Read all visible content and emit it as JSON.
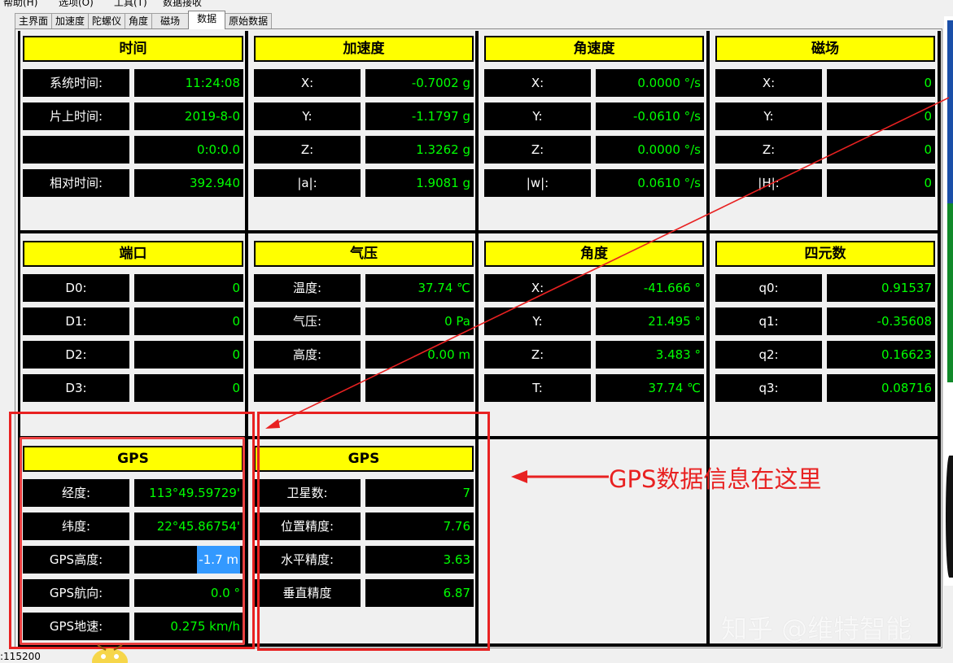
{
  "menubar": [
    "帮助(H)",
    "选项(O)",
    "工具(T)",
    "数据接收"
  ],
  "tabs": [
    "主界面",
    "加速度",
    "陀螺仪",
    "角度",
    "磁场",
    "数据",
    "原始数据"
  ],
  "active_tab": "数据",
  "groups": {
    "time": {
      "title": "时间",
      "rows": [
        {
          "label": "系统时间:",
          "value": "11:24:08"
        },
        {
          "label": "片上时间:",
          "value": "2019-8-0"
        },
        {
          "label": "",
          "value": "0:0:0.0"
        },
        {
          "label": "相对时间:",
          "value": "392.940"
        }
      ]
    },
    "acc": {
      "title": "加速度",
      "rows": [
        {
          "label": "X:",
          "value": "-0.7002 g"
        },
        {
          "label": "Y:",
          "value": "-1.1797 g"
        },
        {
          "label": "Z:",
          "value": "1.3262 g"
        },
        {
          "label": "|a|:",
          "value": "1.9081 g"
        }
      ]
    },
    "gyro": {
      "title": "角速度",
      "rows": [
        {
          "label": "X:",
          "value": "0.0000 °/s"
        },
        {
          "label": "Y:",
          "value": "-0.0610 °/s"
        },
        {
          "label": "Z:",
          "value": "0.0000 °/s"
        },
        {
          "label": "|w|:",
          "value": "0.0610 °/s"
        }
      ]
    },
    "mag": {
      "title": "磁场",
      "rows": [
        {
          "label": "X:",
          "value": "0"
        },
        {
          "label": "Y:",
          "value": "0"
        },
        {
          "label": "Z:",
          "value": "0"
        },
        {
          "label": "|H|:",
          "value": "0"
        }
      ]
    },
    "port": {
      "title": "端口",
      "rows": [
        {
          "label": "D0:",
          "value": "0"
        },
        {
          "label": "D1:",
          "value": "0"
        },
        {
          "label": "D2:",
          "value": "0"
        },
        {
          "label": "D3:",
          "value": "0"
        }
      ]
    },
    "pressure": {
      "title": "气压",
      "rows": [
        {
          "label": "温度:",
          "value": "37.74 ℃"
        },
        {
          "label": "气压:",
          "value": "0 Pa"
        },
        {
          "label": "高度:",
          "value": "0.00 m"
        },
        {
          "label": "",
          "value": ""
        }
      ]
    },
    "angle": {
      "title": "角度",
      "rows": [
        {
          "label": "X:",
          "value": "-41.666 °"
        },
        {
          "label": "Y:",
          "value": "21.495 °"
        },
        {
          "label": "Z:",
          "value": "3.483 °"
        },
        {
          "label": "T:",
          "value": "37.74 ℃"
        }
      ]
    },
    "quat": {
      "title": "四元数",
      "rows": [
        {
          "label": "q0:",
          "value": "0.91537"
        },
        {
          "label": "q1:",
          "value": "-0.35608"
        },
        {
          "label": "q2:",
          "value": "0.16623"
        },
        {
          "label": "q3:",
          "value": "0.08716"
        }
      ]
    },
    "gps1": {
      "title": "GPS",
      "rows": [
        {
          "label": "经度:",
          "value": "113°49.59729'"
        },
        {
          "label": "纬度:",
          "value": "22°45.86754'"
        },
        {
          "label": "GPS高度:",
          "value": "-1.7 m"
        },
        {
          "label": "GPS航向:",
          "value": "0.0 °"
        },
        {
          "label": "GPS地速:",
          "value": "0.275 km/h"
        }
      ]
    },
    "gps2": {
      "title": "GPS",
      "rows": [
        {
          "label": "卫星数:",
          "value": "7"
        },
        {
          "label": "位置精度:",
          "value": "7.76"
        },
        {
          "label": "水平精度:",
          "value": "3.63"
        },
        {
          "label": "垂直精度",
          "value": "6.87"
        }
      ]
    }
  },
  "annotation": "GPS数据信息在这里",
  "watermark": "知乎 @维特智能",
  "status": ":115200",
  "colors": {
    "title_bg": "#ffff00",
    "value_fg": "#00ff00",
    "label_fg": "#ffffff",
    "annotation": "#e82121"
  }
}
